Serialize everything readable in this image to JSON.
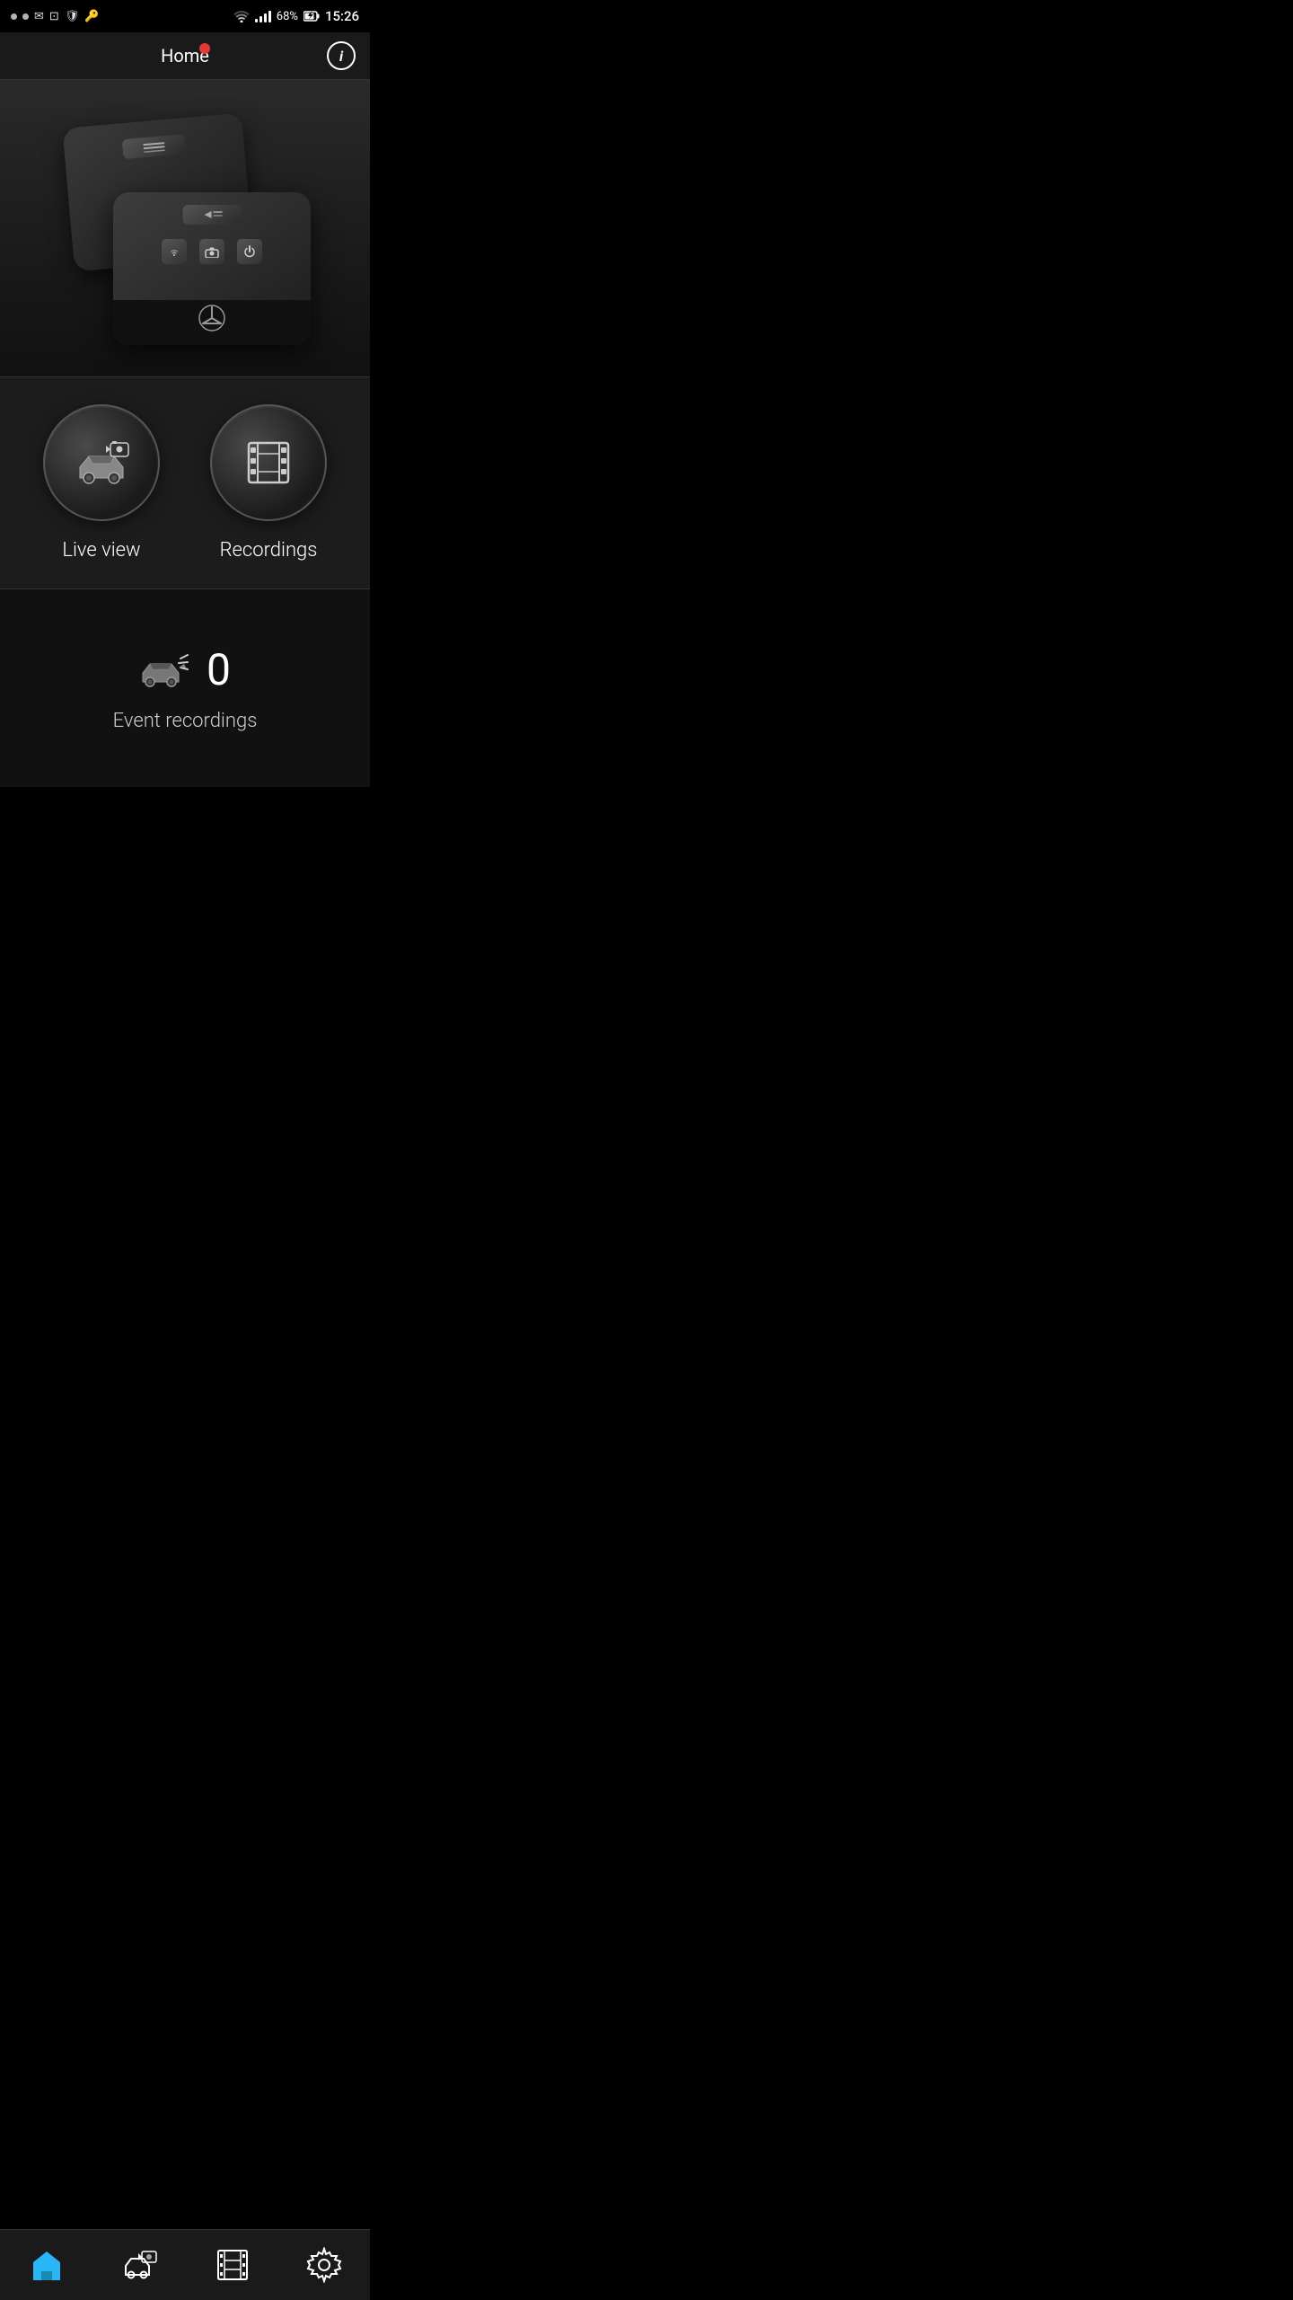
{
  "statusBar": {
    "battery": "68%",
    "time": "15:26",
    "icons": [
      "dots",
      "gmail",
      "box",
      "shield",
      "key"
    ]
  },
  "header": {
    "title": "Home",
    "hasInfoButton": true,
    "hasRecordingDot": true
  },
  "actions": {
    "liveView": {
      "label": "Live view"
    },
    "recordings": {
      "label": "Recordings"
    }
  },
  "eventSection": {
    "count": "0",
    "label": "Event recordings"
  },
  "bottomNav": {
    "items": [
      {
        "id": "home",
        "label": "",
        "icon": "home"
      },
      {
        "id": "camera",
        "label": "",
        "icon": "camera"
      },
      {
        "id": "film",
        "label": "",
        "icon": "film"
      },
      {
        "id": "settings",
        "label": "",
        "icon": "settings"
      }
    ]
  }
}
